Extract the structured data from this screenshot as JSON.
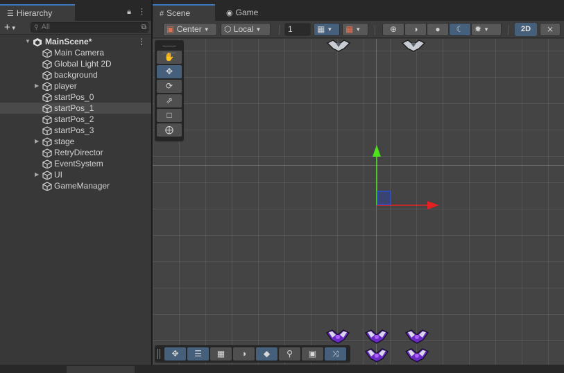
{
  "hierarchy": {
    "tab_label": "Hierarchy",
    "search_placeholder": "All",
    "scene_name": "MainScene*",
    "items": [
      {
        "label": "Main Camera",
        "expandable": false
      },
      {
        "label": "Global Light 2D",
        "expandable": false
      },
      {
        "label": "background",
        "expandable": false
      },
      {
        "label": "player",
        "expandable": true
      },
      {
        "label": "startPos_0",
        "expandable": false
      },
      {
        "label": "startPos_1",
        "expandable": false,
        "selected": true
      },
      {
        "label": "startPos_2",
        "expandable": false
      },
      {
        "label": "startPos_3",
        "expandable": false
      },
      {
        "label": "stage",
        "expandable": true
      },
      {
        "label": "RetryDirector",
        "expandable": false
      },
      {
        "label": "EventSystem",
        "expandable": false
      },
      {
        "label": "UI",
        "expandable": true
      },
      {
        "label": "GameManager",
        "expandable": false
      }
    ]
  },
  "scene_tabs": {
    "scene": "Scene",
    "game": "Game"
  },
  "toolbar": {
    "pivot_label": "Center",
    "space_label": "Local",
    "snap_value": "1",
    "mode_2d_label": "2D"
  },
  "colors": {
    "selection_blue": "#46607c",
    "tab_accent": "#3a79bb",
    "gizmo_y": "#4ee51d",
    "gizmo_x": "#e52020",
    "enemy_purple": "#6a2bc4"
  }
}
